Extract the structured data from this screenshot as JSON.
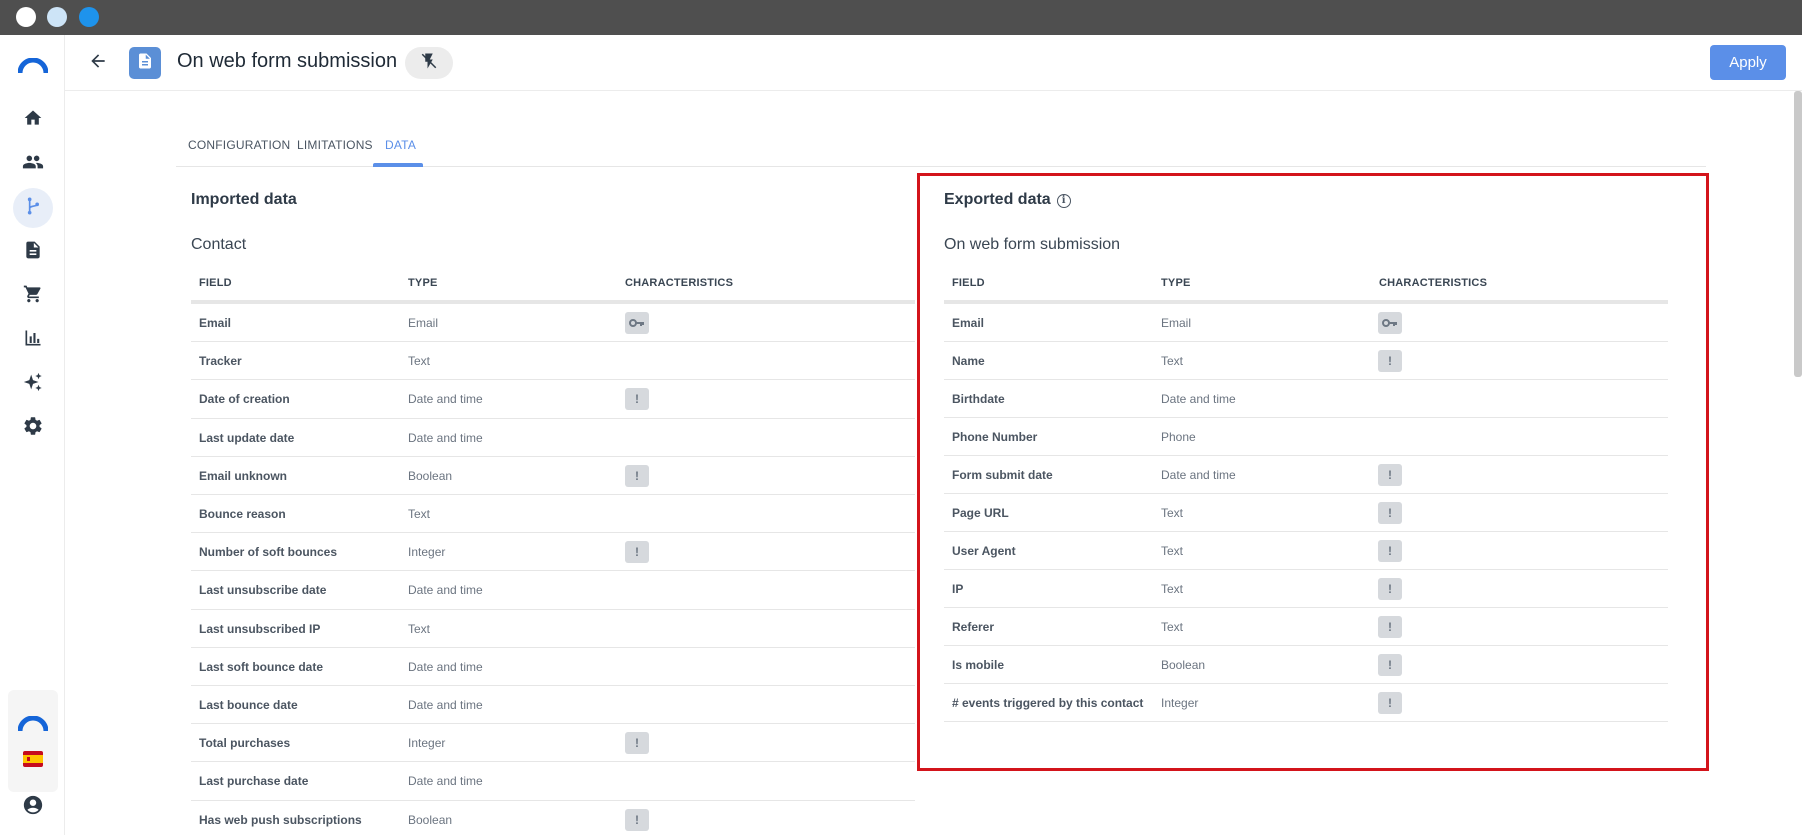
{
  "colors": {
    "accent": "#5b8fe8",
    "highlight": "#d3141b",
    "titlebar": "#4f4f4f",
    "dot1": "#ffffff",
    "dot2": "#cde4f7",
    "dot3": "#1e93ec"
  },
  "sidebar": {
    "items": [
      {
        "name": "home-icon",
        "active": false
      },
      {
        "name": "contacts-icon",
        "active": false
      },
      {
        "name": "workflow-icon",
        "active": true
      },
      {
        "name": "document-icon",
        "active": false
      },
      {
        "name": "cart-icon",
        "active": false
      },
      {
        "name": "stats-icon",
        "active": false
      },
      {
        "name": "sparkle-icon",
        "active": false
      },
      {
        "name": "gear-icon",
        "active": false
      }
    ],
    "bottom": [
      "logo-icon",
      "spain-flag-icon",
      "account-icon"
    ]
  },
  "header": {
    "title": "On web form submission",
    "apply_label": "Apply"
  },
  "tabs": [
    {
      "label": "CONFIGURATION",
      "active": false
    },
    {
      "label": "LIMITATIONS",
      "active": false
    },
    {
      "label": "DATA",
      "active": true
    }
  ],
  "imported": {
    "title": "Imported data",
    "entity": "Contact",
    "columns": {
      "field": "FIELD",
      "type": "TYPE",
      "characteristics": "CHARACTERISTICS"
    },
    "rows": [
      {
        "field": "Email",
        "type": "Email",
        "char": "key"
      },
      {
        "field": "Tracker",
        "type": "Text",
        "char": ""
      },
      {
        "field": "Date of creation",
        "type": "Date and time",
        "char": "!"
      },
      {
        "field": "Last update date",
        "type": "Date and time",
        "char": ""
      },
      {
        "field": "Email unknown",
        "type": "Boolean",
        "char": "!"
      },
      {
        "field": "Bounce reason",
        "type": "Text",
        "char": ""
      },
      {
        "field": "Number of soft bounces",
        "type": "Integer",
        "char": "!"
      },
      {
        "field": "Last unsubscribe date",
        "type": "Date and time",
        "char": ""
      },
      {
        "field": "Last unsubscribed IP",
        "type": "Text",
        "char": ""
      },
      {
        "field": "Last soft bounce date",
        "type": "Date and time",
        "char": ""
      },
      {
        "field": "Last bounce date",
        "type": "Date and time",
        "char": ""
      },
      {
        "field": "Total purchases",
        "type": "Integer",
        "char": "!"
      },
      {
        "field": "Last purchase date",
        "type": "Date and time",
        "char": ""
      },
      {
        "field": "Has web push subscriptions",
        "type": "Boolean",
        "char": "!"
      }
    ]
  },
  "exported": {
    "title": "Exported data",
    "info_glyph": "i",
    "entity": "On web form submission",
    "columns": {
      "field": "FIELD",
      "type": "TYPE",
      "characteristics": "CHARACTERISTICS"
    },
    "rows": [
      {
        "field": "Email",
        "type": "Email",
        "char": "key"
      },
      {
        "field": "Name",
        "type": "Text",
        "char": "!"
      },
      {
        "field": "Birthdate",
        "type": "Date and time",
        "char": ""
      },
      {
        "field": "Phone Number",
        "type": "Phone",
        "char": ""
      },
      {
        "field": "Form submit date",
        "type": "Date and time",
        "char": "!"
      },
      {
        "field": "Page URL",
        "type": "Text",
        "char": "!"
      },
      {
        "field": "User Agent",
        "type": "Text",
        "char": "!"
      },
      {
        "field": "IP",
        "type": "Text",
        "char": "!"
      },
      {
        "field": "Referer",
        "type": "Text",
        "char": "!"
      },
      {
        "field": "Is mobile",
        "type": "Boolean",
        "char": "!"
      },
      {
        "field": "# events triggered by this contact",
        "type": "Integer",
        "char": "!"
      }
    ]
  }
}
